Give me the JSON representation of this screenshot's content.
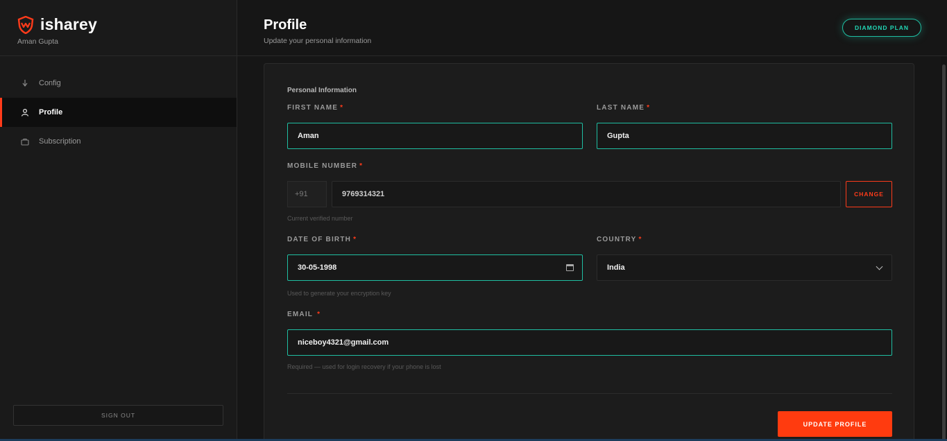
{
  "brand": {
    "name": "isharey",
    "user": "Aman Gupta"
  },
  "colors": {
    "accent": "#ff3b1a",
    "teal": "#1fbfa3",
    "background": "#161616"
  },
  "sidebar": {
    "items": [
      {
        "label": "Config",
        "icon": "config-icon"
      },
      {
        "label": "Profile",
        "icon": "user-icon"
      },
      {
        "label": "Subscription",
        "icon": "briefcase-icon"
      }
    ],
    "sign_out": "SIGN OUT"
  },
  "header": {
    "title": "Profile",
    "subtitle": "Update your personal information",
    "plan": "DIAMOND PLAN"
  },
  "form": {
    "section_title": "Personal Information",
    "first_name": {
      "label": "FIRST NAME",
      "required": "*",
      "value": "Aman"
    },
    "last_name": {
      "label": "LAST NAME",
      "required": "*",
      "value": "Gupta"
    },
    "mobile": {
      "label": "MOBILE NUMBER",
      "required": "*",
      "prefix": "+91",
      "value": "9769314321",
      "change": "CHANGE",
      "hint": "Current verified number"
    },
    "dob": {
      "label": "DATE OF BIRTH",
      "required": "*",
      "value": "30-05-1998",
      "hint": "Used to generate your encryption key"
    },
    "country": {
      "label": "COUNTRY",
      "required": "*",
      "value": "India"
    },
    "email": {
      "label": "EMAIL",
      "required": "*",
      "value": "niceboy4321@gmail.com",
      "hint": "Required — used for login recovery if your phone is lost"
    },
    "submit": "UPDATE PROFILE"
  }
}
